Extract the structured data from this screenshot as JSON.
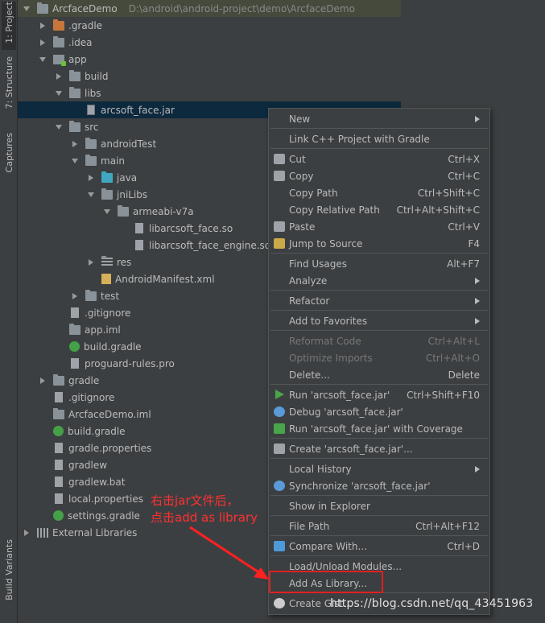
{
  "toolwindows": {
    "left": [
      {
        "label": "1: Project",
        "active": true
      },
      {
        "label": "7: Structure",
        "active": false
      },
      {
        "label": "Captures",
        "active": false
      },
      {
        "label": "Build Variants",
        "active": false
      }
    ]
  },
  "project": {
    "name": "ArcfaceDemo",
    "path": "D:\\android\\android-project\\demo\\ArcfaceDemo",
    "tree": [
      {
        "label": ".gradle",
        "icon": "folder-orange-icon"
      },
      {
        "label": ".idea",
        "icon": "folder-icon"
      },
      {
        "label": "app",
        "icon": "module-folder-icon"
      },
      {
        "label": "build",
        "icon": "folder-icon"
      },
      {
        "label": "libs",
        "icon": "folder-icon"
      },
      {
        "label": "arcsoft_face.jar",
        "icon": "jar-file-icon",
        "selected": true
      },
      {
        "label": "src",
        "icon": "folder-icon"
      },
      {
        "label": "androidTest",
        "icon": "folder-icon"
      },
      {
        "label": "main",
        "icon": "folder-icon"
      },
      {
        "label": "java",
        "icon": "source-folder-icon"
      },
      {
        "label": "jniLibs",
        "icon": "folder-icon"
      },
      {
        "label": "armeabi-v7a",
        "icon": "folder-icon"
      },
      {
        "label": "libarcsoft_face.so",
        "icon": "file-icon"
      },
      {
        "label": "libarcsoft_face_engine.so",
        "icon": "file-icon"
      },
      {
        "label": "res",
        "icon": "resources-folder-icon"
      },
      {
        "label": "AndroidManifest.xml",
        "icon": "xml-file-icon"
      },
      {
        "label": "test",
        "icon": "folder-icon"
      },
      {
        "label": ".gitignore",
        "icon": "file-icon"
      },
      {
        "label": "app.iml",
        "icon": "iml-file-icon"
      },
      {
        "label": "build.gradle",
        "icon": "gradle-icon"
      },
      {
        "label": "proguard-rules.pro",
        "icon": "file-icon"
      },
      {
        "label": "gradle",
        "icon": "folder-icon"
      },
      {
        "label": ".gitignore",
        "icon": "file-icon"
      },
      {
        "label": "ArcfaceDemo.iml",
        "icon": "iml-file-icon"
      },
      {
        "label": "build.gradle",
        "icon": "gradle-icon"
      },
      {
        "label": "gradle.properties",
        "icon": "file-icon"
      },
      {
        "label": "gradlew",
        "icon": "file-icon"
      },
      {
        "label": "gradlew.bat",
        "icon": "file-icon"
      },
      {
        "label": "local.properties",
        "icon": "file-icon"
      },
      {
        "label": "settings.gradle",
        "icon": "gradle-icon"
      },
      {
        "label": "External Libraries",
        "icon": "libraries-icon"
      }
    ]
  },
  "context_menu": {
    "items": [
      {
        "label": "New",
        "submenu": true
      },
      {
        "label": "Link C++ Project with Gradle"
      },
      {
        "label": "Cut",
        "shortcut": "Ctrl+X",
        "icon": "scissors-icon"
      },
      {
        "label": "Copy",
        "shortcut": "Ctrl+C",
        "icon": "copy-icon"
      },
      {
        "label": "Copy Path",
        "shortcut": "Ctrl+Shift+C"
      },
      {
        "label": "Copy Relative Path",
        "shortcut": "Ctrl+Alt+Shift+C"
      },
      {
        "label": "Paste",
        "shortcut": "Ctrl+V",
        "icon": "paste-icon"
      },
      {
        "label": "Jump to Source",
        "shortcut": "F4",
        "icon": "edit-icon"
      },
      {
        "label": "Find Usages",
        "shortcut": "Alt+F7"
      },
      {
        "label": "Analyze",
        "submenu": true
      },
      {
        "label": "Refactor",
        "submenu": true
      },
      {
        "label": "Add to Favorites",
        "submenu": true
      },
      {
        "label": "Reformat Code",
        "shortcut": "Ctrl+Alt+L",
        "disabled": true
      },
      {
        "label": "Optimize Imports",
        "shortcut": "Ctrl+Alt+O",
        "disabled": true
      },
      {
        "label": "Delete...",
        "shortcut": "Delete"
      },
      {
        "label": "Run 'arcsoft_face.jar'",
        "shortcut": "Ctrl+Shift+F10",
        "icon": "run-icon"
      },
      {
        "label": "Debug 'arcsoft_face.jar'",
        "icon": "debug-icon"
      },
      {
        "label": "Run 'arcsoft_face.jar' with Coverage",
        "icon": "coverage-icon"
      },
      {
        "label": "Create 'arcsoft_face.jar'...",
        "icon": "create-config-icon"
      },
      {
        "label": "Local History",
        "submenu": true
      },
      {
        "label": "Synchronize 'arcsoft_face.jar'",
        "icon": "sync-icon"
      },
      {
        "label": "Show in Explorer"
      },
      {
        "label": "File Path",
        "shortcut": "Ctrl+Alt+F12"
      },
      {
        "label": "Compare With...",
        "shortcut": "Ctrl+D",
        "icon": "compare-icon"
      },
      {
        "label": "Load/Unload Modules..."
      },
      {
        "label": "Add As Library...",
        "highlighted": true
      },
      {
        "label": "Create Gist...",
        "icon": "github-icon"
      }
    ]
  },
  "annotation": {
    "line1": "右击jar文件后，",
    "line2": "点击add as library",
    "color": "#ff3030"
  },
  "watermark": "https://blog.csdn.net/qq_43451963"
}
